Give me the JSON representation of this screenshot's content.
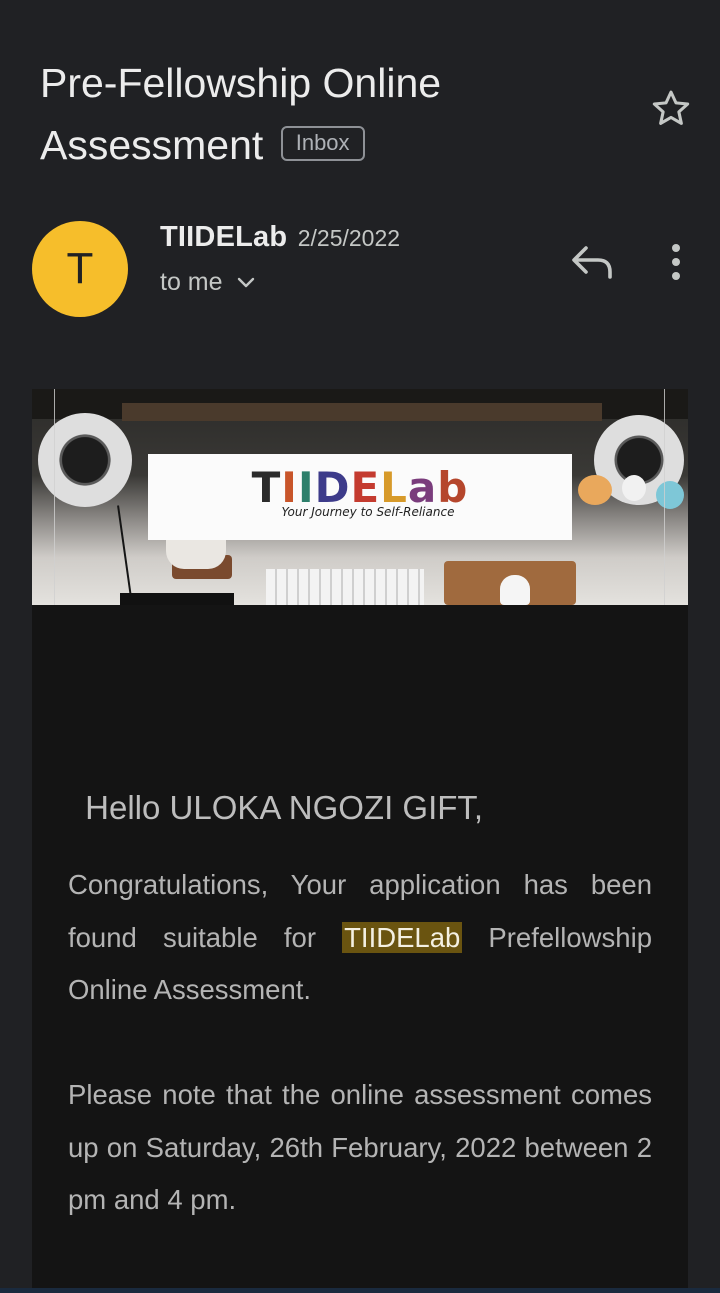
{
  "email": {
    "subject_line1": "Pre-Fellowship Online",
    "subject_line2": "Assessment",
    "label": "Inbox",
    "sender_initial": "T",
    "sender_name": "TIIDELab",
    "date": "2/25/2022",
    "recipient": "to me"
  },
  "icons": {
    "star": "star-outline-icon",
    "reply": "reply-icon",
    "more": "more-vert-icon",
    "expand": "chevron-down-icon"
  },
  "banner": {
    "logo_letters": [
      "T",
      "I",
      "I",
      "D",
      "E",
      "L",
      "a",
      "b"
    ],
    "logo_colors": [
      "#2b2b2b",
      "#c8552a",
      "#2d7f6b",
      "#3d3b8a",
      "#c43b2f",
      "#d79a2a",
      "#7a3c7c",
      "#b5462c"
    ],
    "tagline": "Your Journey to Self-Reliance"
  },
  "body": {
    "greeting": " Hello ULOKA NGOZI GIFT,",
    "p1_before": "Congratulations, Your application has been found suitable for ",
    "p1_highlight": "TIIDELab",
    "p1_after": " Prefellowship Online Assessment.",
    "p2": "Please note that the online assessment comes up on Saturday, 26th February, 2022 between 2 pm and 4 pm."
  },
  "colors": {
    "background": "#202124",
    "avatar": "#f6be2b",
    "highlight": "#6a5410"
  }
}
